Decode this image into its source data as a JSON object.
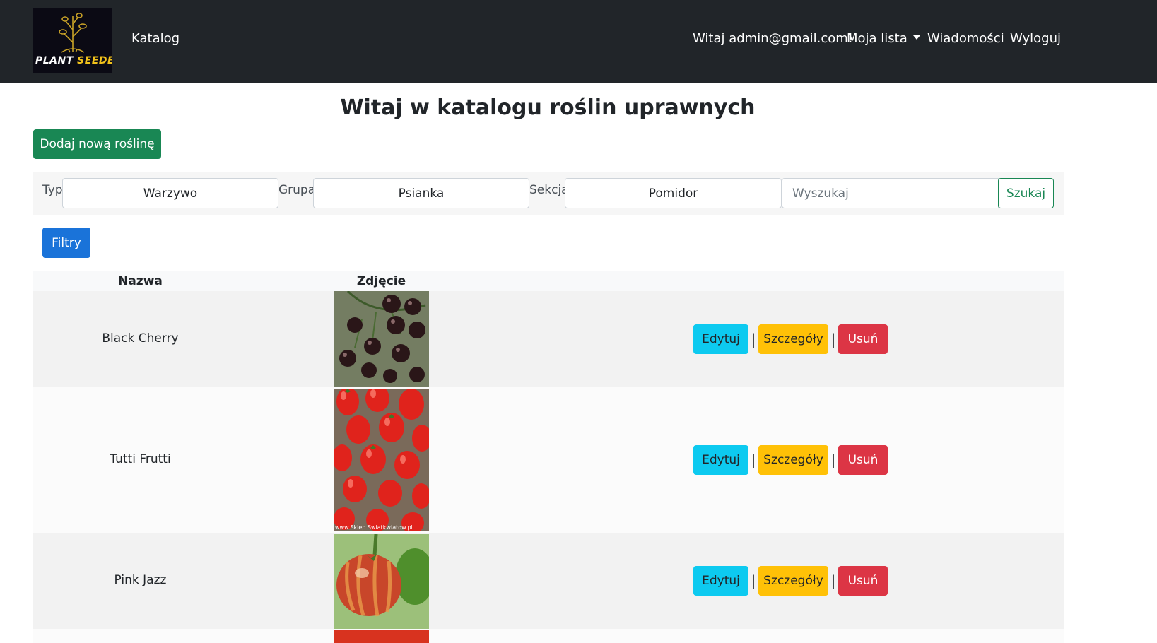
{
  "navbar": {
    "logo_text_1": "PLANT",
    "logo_text_2": "SEEDER",
    "catalog": "Katalog",
    "greeting": "Witaj admin@gmail.com!",
    "my_list": "Moja lista",
    "messages": "Wiadomości",
    "logout": "Wyloguj"
  },
  "page": {
    "title": "Witaj w katalogu roślin uprawnych",
    "add_button": "Dodaj nową roślinę"
  },
  "filters": {
    "type_label": "Typ",
    "type_value": "Warzywo",
    "group_label": "Grupa",
    "group_value": "Psianka",
    "section_label": "Sekcja",
    "section_value": "Pomidor",
    "search_placeholder": "Wyszukaj",
    "search_button": "Szukaj",
    "filters_button": "Filtry"
  },
  "table": {
    "col_name": "Nazwa",
    "col_photo": "Zdjęcie",
    "edit_label": "Edytuj",
    "details_label": "Szczegóły",
    "delete_label": "Usuń",
    "separator": "|",
    "rows": [
      {
        "name": "Black Cherry",
        "photo_icon": "dark-cherry-tomatoes-photo"
      },
      {
        "name": "Tutti Frutti",
        "photo_icon": "red-plum-tomatoes-photo",
        "watermark": "www.Sklep.Swiatkwiatow.pl"
      },
      {
        "name": "Pink Jazz",
        "photo_icon": "striped-tomato-photo"
      }
    ]
  },
  "colors": {
    "navbar": "#212529",
    "success": "#198754",
    "primary": "#1a73d9",
    "info": "#0dcaf0",
    "warning": "#ffc107",
    "danger": "#dc3545"
  }
}
